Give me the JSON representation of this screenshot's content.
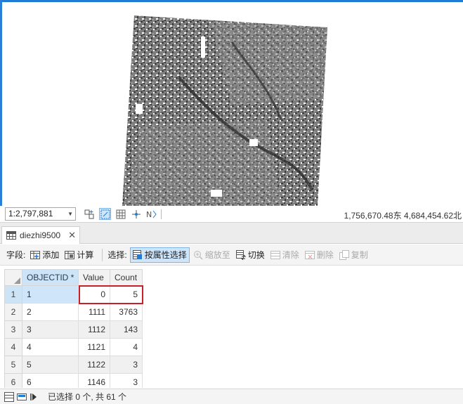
{
  "map": {
    "scale": "1:2,797,881",
    "coordinates": "1,756,670.48东 4,684,454.62北",
    "colors": {
      "raster_dark": "#3d3d3d",
      "raster_mid": "#7a7a7a",
      "raster_light": "#9c9c9c",
      "accent": "#1e7bd6"
    }
  },
  "map_tools": [
    {
      "icon": "grid-snap-icon"
    },
    {
      "icon": "dynamic-constraints-icon",
      "active": true
    },
    {
      "icon": "grid-icon"
    },
    {
      "icon": "cross-hair-icon"
    },
    {
      "icon": "snapping-icon"
    }
  ],
  "tab": {
    "label": "diezhi9500",
    "icon": "table-icon"
  },
  "toolbar": {
    "field_label": "字段:",
    "add_label": "添加",
    "calculate_label": "计算",
    "selection_label": "选择:",
    "select_by_attr_label": "按属性选择",
    "zoom_to_label": "缩放至",
    "switch_label": "切换",
    "clear_label": "清除",
    "delete_label": "删除",
    "copy_label": "复制"
  },
  "table": {
    "columns": [
      "OBJECTID *",
      "Value",
      "Count"
    ],
    "rows": [
      {
        "row_num": "1",
        "objectid": "1",
        "value": "0",
        "count": "5"
      },
      {
        "row_num": "2",
        "objectid": "2",
        "value": "1111",
        "count": "3763"
      },
      {
        "row_num": "3",
        "objectid": "3",
        "value": "1112",
        "count": "143"
      },
      {
        "row_num": "4",
        "objectid": "4",
        "value": "1121",
        "count": "4"
      },
      {
        "row_num": "5",
        "objectid": "5",
        "value": "1122",
        "count": "3"
      },
      {
        "row_num": "6",
        "objectid": "6",
        "value": "1146",
        "count": "3"
      }
    ],
    "highlight_color": "#c8202a"
  },
  "status": {
    "selection_text": "已选择 0 个, 共 61 个"
  }
}
